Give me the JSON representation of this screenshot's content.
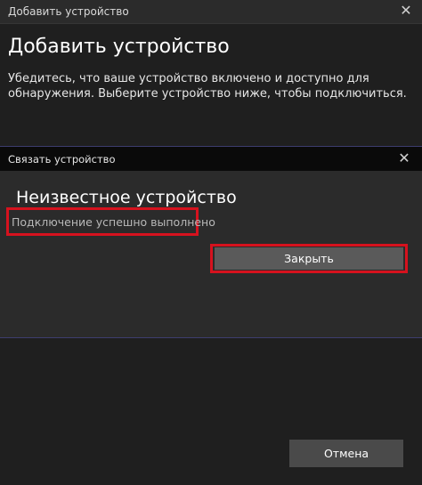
{
  "window": {
    "title": "Добавить устройство",
    "close_glyph": "✕"
  },
  "main": {
    "heading": "Добавить устройство",
    "description": "Убедитесь, что ваше устройство включено и доступно для обнаружения. Выберите устройство ниже, чтобы подключиться.",
    "cancel_label": "Отмена"
  },
  "dialog": {
    "title": "Связать устройство",
    "close_glyph": "✕",
    "device_name": "Неизвестное устройство",
    "status": "Подключение успешно выполнено",
    "close_button_label": "Закрыть"
  },
  "colors": {
    "highlight": "#d6121e",
    "background": "#1f1f1f",
    "dialog_background": "#2b2b2b",
    "button": "#5a5a5a"
  }
}
